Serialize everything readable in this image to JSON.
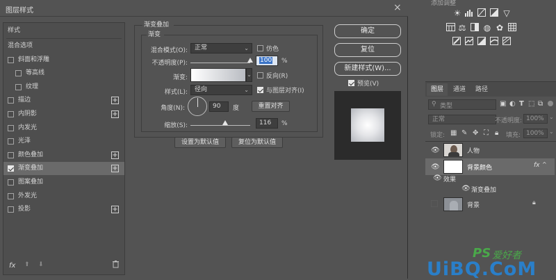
{
  "dialog": {
    "title": "图层样式",
    "close_glyph": "×"
  },
  "style_list": {
    "header": "样式",
    "items": [
      {
        "label": "混合选项",
        "checkbox": false,
        "checked": false,
        "plus": false,
        "indent": false,
        "selected": false
      },
      {
        "label": "斜面和浮雕",
        "checkbox": true,
        "checked": false,
        "plus": false,
        "indent": false,
        "selected": false
      },
      {
        "label": "等高线",
        "checkbox": true,
        "checked": false,
        "plus": false,
        "indent": true,
        "selected": false
      },
      {
        "label": "纹理",
        "checkbox": true,
        "checked": false,
        "plus": false,
        "indent": true,
        "selected": false
      },
      {
        "label": "描边",
        "checkbox": true,
        "checked": false,
        "plus": true,
        "indent": false,
        "selected": false
      },
      {
        "label": "内阴影",
        "checkbox": true,
        "checked": false,
        "plus": true,
        "indent": false,
        "selected": false
      },
      {
        "label": "内发光",
        "checkbox": true,
        "checked": false,
        "plus": false,
        "indent": false,
        "selected": false
      },
      {
        "label": "光泽",
        "checkbox": true,
        "checked": false,
        "plus": false,
        "indent": false,
        "selected": false
      },
      {
        "label": "颜色叠加",
        "checkbox": true,
        "checked": false,
        "plus": true,
        "indent": false,
        "selected": false
      },
      {
        "label": "渐变叠加",
        "checkbox": true,
        "checked": true,
        "plus": true,
        "indent": false,
        "selected": true
      },
      {
        "label": "图案叠加",
        "checkbox": true,
        "checked": false,
        "plus": false,
        "indent": false,
        "selected": false
      },
      {
        "label": "外发光",
        "checkbox": true,
        "checked": false,
        "plus": false,
        "indent": false,
        "selected": false
      },
      {
        "label": "投影",
        "checkbox": true,
        "checked": false,
        "plus": true,
        "indent": false,
        "selected": false
      }
    ],
    "footer_fx": "fx",
    "icons": [
      "fx-icon",
      "arrow-up-icon",
      "arrow-down-icon",
      "trash-icon"
    ]
  },
  "gradient_overlay": {
    "group_title": "渐变叠加",
    "sub_title": "渐变",
    "blend_mode_label": "混合模式(O):",
    "blend_mode_value": "正常",
    "dither_label": "仿色",
    "dither_checked": false,
    "opacity_label": "不透明度(P):",
    "opacity_value": "100",
    "opacity_unit": "%",
    "opacity_fraction": 1.0,
    "gradient_label": "渐变:",
    "reverse_label": "反向(R)",
    "reverse_checked": false,
    "style_label": "样式(L):",
    "style_value": "径向",
    "align_label": "与图层对齐(I)",
    "align_checked": true,
    "angle_label": "角度(N):",
    "angle_value": "90",
    "angle_unit": "度",
    "reset_align_label": "重置对齐",
    "scale_label": "缩放(S):",
    "scale_value": "116",
    "scale_unit": "%",
    "scale_fraction": 0.58,
    "make_default_label": "设置为默认值",
    "reset_default_label": "复位为默认值"
  },
  "buttons": {
    "ok": "确定",
    "reset": "复位",
    "new_style": "新建样式(W)...",
    "preview_label": "预览(V)",
    "preview_checked": true
  },
  "right_panel": {
    "top_label": "添加调整",
    "tabs": [
      "图层",
      "通道",
      "路径"
    ],
    "active_tab": "图层",
    "filter_placeholder": "类型",
    "blend_mode": "正常",
    "opacity_label": "不透明度:",
    "opacity_value": "100%",
    "lock_label": "锁定:",
    "fill_label": "填充:",
    "fill_value": "100%",
    "layers": [
      {
        "name": "人物",
        "visible": true,
        "thumbnail": "portrait-thumbnail",
        "locked": false,
        "fx": false
      },
      {
        "name": "背景颜色",
        "visible": true,
        "thumbnail": "white-thumbnail",
        "locked": false,
        "fx": true,
        "selected": true
      },
      {
        "name": "效果",
        "visible": true,
        "sub": true
      },
      {
        "name": "渐变叠加",
        "visible": true,
        "sub": true
      },
      {
        "name": "背景",
        "visible": false,
        "thumbnail": "photo-thumbnail",
        "locked": true,
        "fx": false
      }
    ],
    "fx_label": "fx"
  },
  "watermark": {
    "ps_text": "PS",
    "cn_text": "爱好者",
    "brand": "UiBQ.CoM"
  },
  "colors": {
    "background": "#535353",
    "panel_dark": "#3e3e3e",
    "selected_row": "#6a6a6a",
    "watermark_green": "#4aa84a",
    "watermark_blue": "#2a7fc9"
  }
}
